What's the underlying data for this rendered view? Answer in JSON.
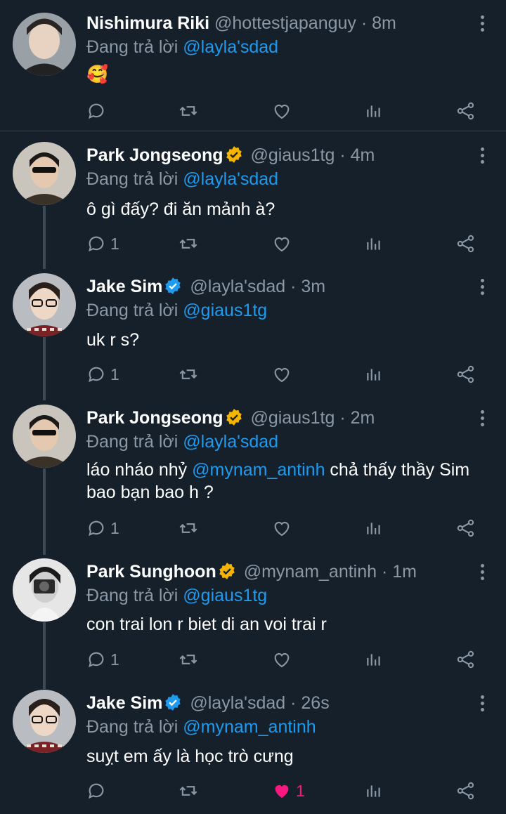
{
  "reply_prefix": "Đang trả lời",
  "tweets": [
    {
      "name": "Nishimura Riki",
      "verified": false,
      "handle": "@hottestjapanguy",
      "time": "· 8m",
      "reply_to": "@layla'sdad",
      "text": "🥰",
      "reply_count": "",
      "liked": false,
      "like_count": ""
    },
    {
      "name": "Park Jongseong",
      "verified": true,
      "badge_color": "#f4b400",
      "handle": "@giaus1tg",
      "time": "· 4m",
      "reply_to": "@layla'sdad",
      "text": "ô gì đấy? đi ăn mảnh à?",
      "reply_count": "1",
      "liked": false,
      "like_count": ""
    },
    {
      "name": "Jake Sim",
      "verified": true,
      "badge_color": "#1d9bf0",
      "handle": "@layla'sdad",
      "time": "· 3m",
      "reply_to": "@giaus1tg",
      "text": "uk r s?",
      "reply_count": "1",
      "liked": false,
      "like_count": ""
    },
    {
      "name": "Park Jongseong",
      "verified": true,
      "badge_color": "#f4b400",
      "handle": "@giaus1tg",
      "time": "· 2m",
      "reply_to": "@layla'sdad",
      "text_before": "láo nháo nhỷ ",
      "text_mention": "@mynam_antinh",
      "text_after": " chả thấy thầy Sim bao bạn bao h ?",
      "reply_count": "1",
      "liked": false,
      "like_count": ""
    },
    {
      "name": "Park Sunghoon",
      "verified": true,
      "badge_color": "#f4b400",
      "handle": "@mynam_antinh",
      "time": "· 1m",
      "reply_to": "@giaus1tg",
      "text": "con trai lon r biet di an voi trai r",
      "reply_count": "1",
      "liked": false,
      "like_count": ""
    },
    {
      "name": "Jake Sim",
      "verified": true,
      "badge_color": "#1d9bf0",
      "handle": "@layla'sdad",
      "time": "· 26s",
      "reply_to": "@mynam_antinh",
      "text": "suỵt em ấy là học trò cưng",
      "reply_count": "",
      "liked": true,
      "like_count": "1"
    }
  ],
  "colors": {
    "background": "#15202b",
    "secondary": "#8b98a5",
    "link": "#1d9bf0",
    "like": "#f91880"
  },
  "icons": [
    "reply-icon",
    "retweet-icon",
    "like-icon",
    "analytics-icon",
    "share-icon",
    "more-icon",
    "verified-badge-icon"
  ]
}
